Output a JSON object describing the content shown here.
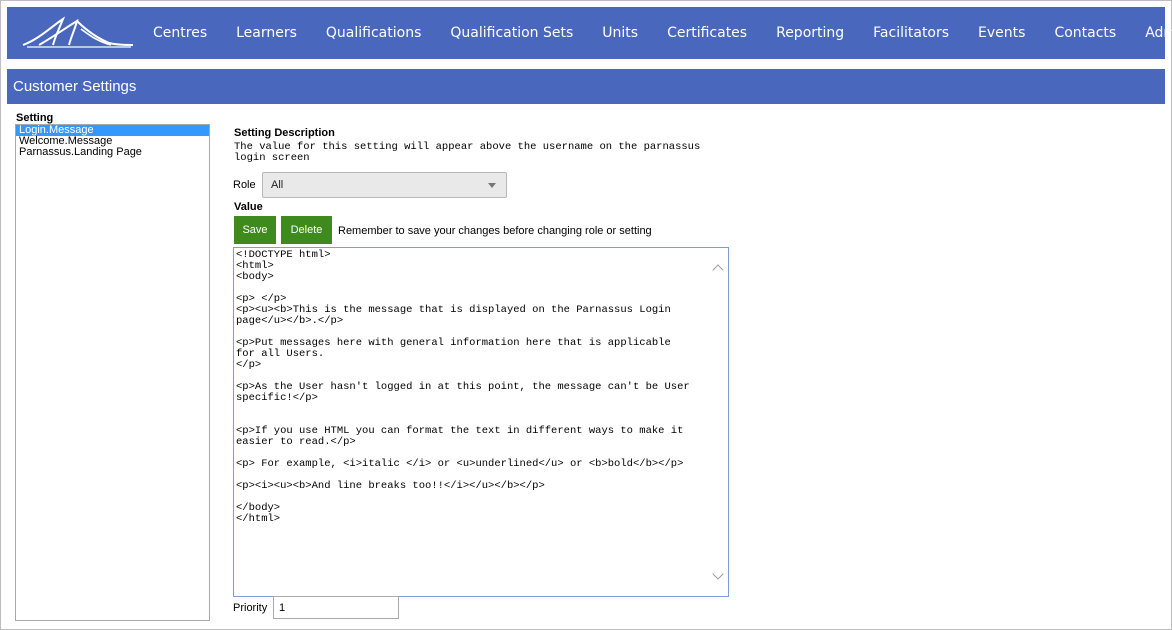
{
  "nav": {
    "logo": "mountain-logo-icon",
    "items": [
      "Centres",
      "Learners",
      "Qualifications",
      "Qualification Sets",
      "Units",
      "Certificates",
      "Reporting",
      "Facilitators",
      "Events",
      "Contacts",
      "Admin"
    ]
  },
  "page": {
    "title": "Customer Settings"
  },
  "settings": {
    "label": "Setting",
    "items": [
      "Login.Message",
      "Welcome.Message",
      "Parnassus.Landing Page"
    ],
    "selected": "Login.Message"
  },
  "description": {
    "label": "Setting Description",
    "text": "The value for this setting will appear above the username on the parnassus\nlogin screen"
  },
  "role": {
    "label": "Role",
    "value": "All"
  },
  "value": {
    "label": "Value",
    "save_label": "Save",
    "delete_label": "Delete",
    "reminder": "Remember to save your changes before changing role or setting",
    "content": "<!DOCTYPE html>\n<html>\n<body>\n\n<p> </p>\n<p><u><b>This is the message that is displayed on the Parnassus Login\npage</u></b>.</p>\n\n<p>Put messages here with general information here that is applicable\nfor all Users.\n</p>\n\n<p>As the User hasn't logged in at this point, the message can't be User\nspecific!</p>\n\n\n<p>If you use HTML you can format the text in different ways to make it\neasier to read.</p>\n\n<p> For example, <i>italic </i> or <u>underlined</u> or <b>bold</b></p>\n\n<p><i><u><b>And line breaks too!!</i></u></b></p>\n\n</body>\n</html>"
  },
  "priority": {
    "label": "Priority",
    "value": "1"
  },
  "colors": {
    "nav_bg": "#4a67be",
    "button_green": "#3f8a1c",
    "selected_item": "#3399ff"
  }
}
